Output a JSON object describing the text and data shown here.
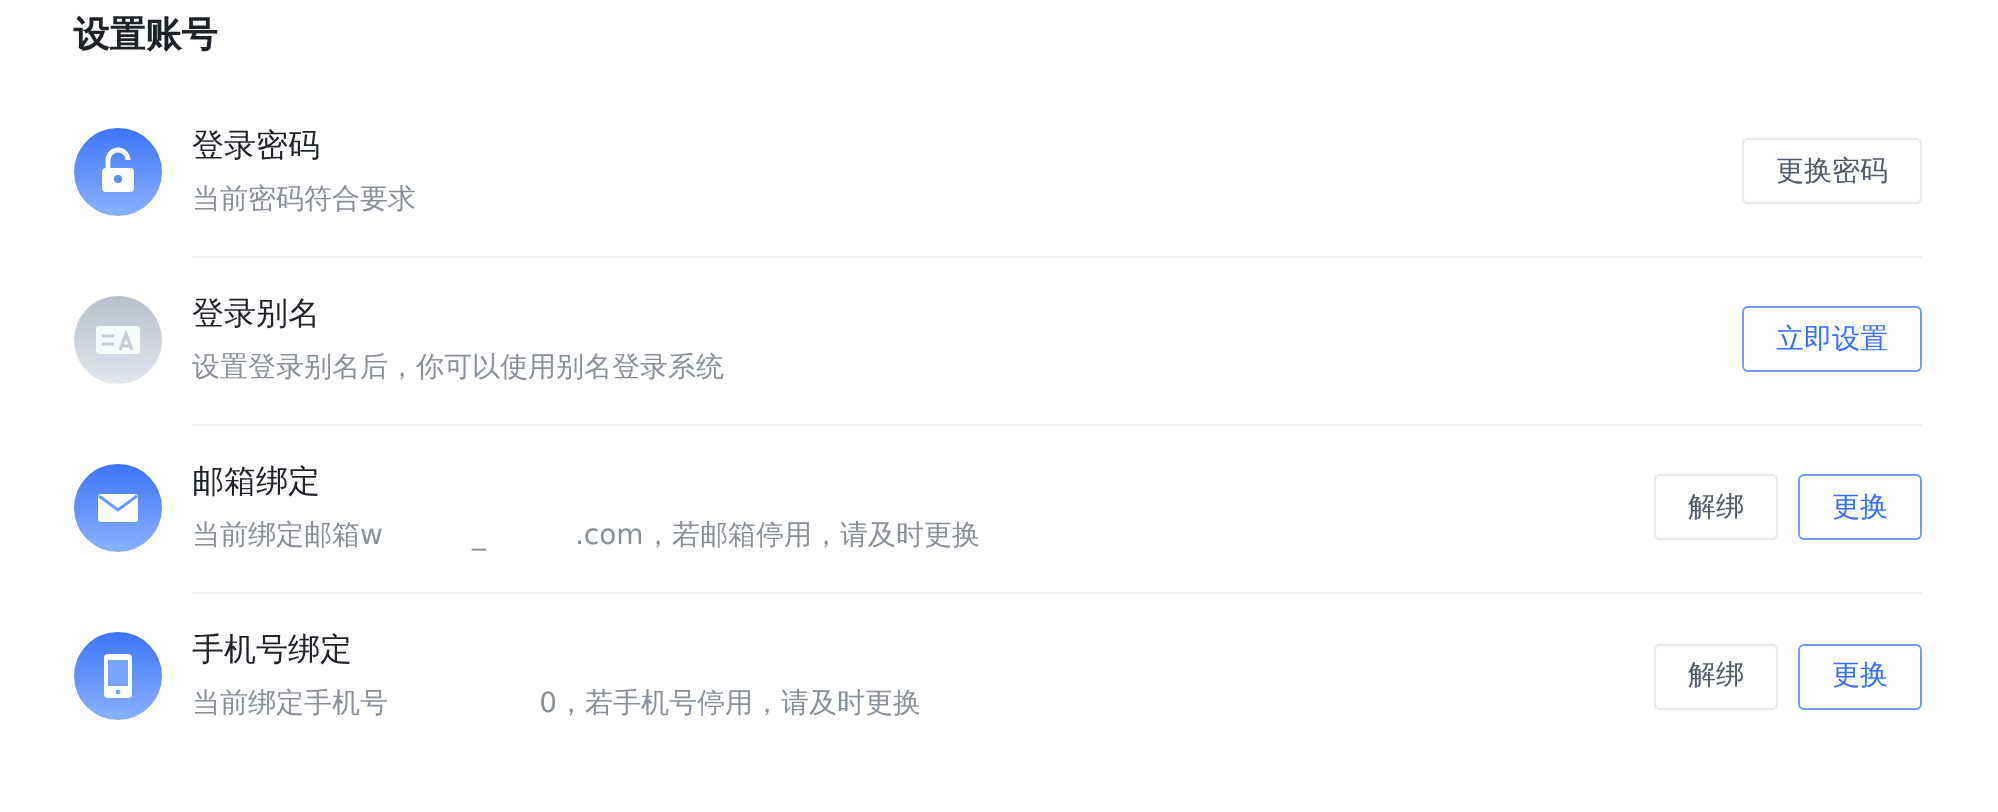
{
  "section": {
    "title": "设置账号"
  },
  "items": [
    {
      "kind": "lock",
      "title": "登录密码",
      "description": "当前密码符合要求",
      "buttons": [
        {
          "label": "更换密码",
          "kind": "default"
        }
      ]
    },
    {
      "kind": "alias",
      "title": "登录别名",
      "description": "设置登录别名后，你可以使用别名登录系统",
      "buttons": [
        {
          "label": "立即设置",
          "kind": "primary"
        }
      ]
    },
    {
      "kind": "mail",
      "title": "邮箱绑定",
      "description": "当前绑定邮箱w          _          .com，若邮箱停用，请及时更换",
      "buttons": [
        {
          "label": "解绑",
          "kind": "default"
        },
        {
          "label": "更换",
          "kind": "primary"
        }
      ]
    },
    {
      "kind": "phone",
      "title": "手机号绑定",
      "description": "当前绑定手机号                 0，若手机号停用，请及时更换",
      "buttons": [
        {
          "label": "解绑",
          "kind": "default"
        },
        {
          "label": "更换",
          "kind": "primary"
        }
      ]
    }
  ]
}
